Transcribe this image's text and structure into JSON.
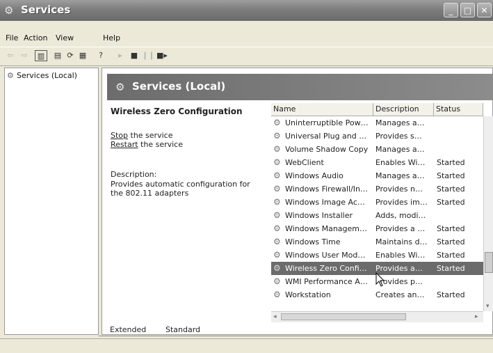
{
  "window": {
    "title": "Services"
  },
  "menu": {
    "items": [
      "File",
      "Action",
      "View",
      "Help"
    ]
  },
  "toolbar": {
    "buttons": [
      "back-icon",
      "forward-icon",
      "show-hide-tree-icon",
      "properties-icon",
      "refresh-icon",
      "export-list-icon",
      "help-icon",
      "start-icon",
      "stop-icon",
      "pause-icon",
      "restart-icon"
    ]
  },
  "tree": {
    "root_label": "Services (Local)"
  },
  "banner": {
    "title": "Services (Local)"
  },
  "detail": {
    "service_name": "Wireless Zero Configuration",
    "stop_link": "Stop",
    "stop_suffix": " the service",
    "restart_link": "Restart",
    "restart_suffix": " the service",
    "description_label": "Description:",
    "description_text": "Provides automatic configuration for the 802.11 adapters"
  },
  "list": {
    "columns": [
      "Name",
      "Description",
      "Status"
    ],
    "rows": [
      {
        "name": "Uninterruptible Pow…",
        "description": "Manages a…",
        "status": ""
      },
      {
        "name": "Universal Plug and …",
        "description": "Provides s…",
        "status": ""
      },
      {
        "name": "Volume Shadow Copy",
        "description": "Manages a…",
        "status": ""
      },
      {
        "name": "WebClient",
        "description": "Enables Wi…",
        "status": "Started"
      },
      {
        "name": "Windows Audio",
        "description": "Manages a…",
        "status": "Started"
      },
      {
        "name": "Windows Firewall/In…",
        "description": "Provides n…",
        "status": "Started"
      },
      {
        "name": "Windows Image Ac…",
        "description": "Provides im…",
        "status": "Started"
      },
      {
        "name": "Windows Installer",
        "description": "Adds, modi…",
        "status": ""
      },
      {
        "name": "Windows Managem…",
        "description": "Provides a …",
        "status": "Started"
      },
      {
        "name": "Windows Time",
        "description": "Maintains d…",
        "status": "Started"
      },
      {
        "name": "Windows User Mod…",
        "description": "Enables Wi…",
        "status": "Started"
      },
      {
        "name": "Wireless Zero Confi…",
        "description": "Provides a…",
        "status": "Started",
        "selected": true
      },
      {
        "name": "WMI Performance A…",
        "description": "Provides p…",
        "status": ""
      },
      {
        "name": "Workstation",
        "description": "Creates an…",
        "status": "Started"
      }
    ]
  },
  "tabs": [
    "Extended",
    "Standard"
  ]
}
